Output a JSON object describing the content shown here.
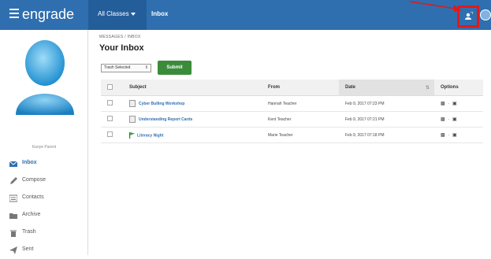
{
  "brand": "engrade",
  "topbar": {
    "classes_label": "All Classes",
    "section_label": "Inbox"
  },
  "profile": {
    "name": "Kanye Parent"
  },
  "sidebar": {
    "items": [
      {
        "label": "Inbox",
        "icon": "envelope-icon",
        "active": true
      },
      {
        "label": "Compose",
        "icon": "pencil-icon"
      },
      {
        "label": "Contacts",
        "icon": "address-card-icon"
      },
      {
        "label": "Archive",
        "icon": "folder-icon"
      },
      {
        "label": "Trash",
        "icon": "trash-icon"
      },
      {
        "label": "Sent",
        "icon": "paper-plane-icon"
      }
    ]
  },
  "main": {
    "breadcrumb": "MESSAGES / INBOX",
    "title": "Your Inbox",
    "action_select": "Trash Selected",
    "submit_label": "Submit",
    "columns": [
      "Subject",
      "From",
      "Date",
      "Options"
    ],
    "rows": [
      {
        "subject": "Cyber Bulling Workshop",
        "from": "Hannah Teacher",
        "date": "Feb 9, 2017 07:23 PM",
        "icon": "document-icon"
      },
      {
        "subject": "Understanding Report Cards",
        "from": "Kent Teacher",
        "date": "Feb 9, 2017 07:21 PM",
        "icon": "document-icon"
      },
      {
        "subject": "Literacy Night",
        "from": "Marie Teacher",
        "date": "Feb 9, 2017 07:18 PM",
        "icon": "flag-icon"
      }
    ]
  },
  "colors": {
    "accent": "#2f6fb0",
    "submit": "#3a8c3a",
    "highlight": "#e01a1a"
  }
}
